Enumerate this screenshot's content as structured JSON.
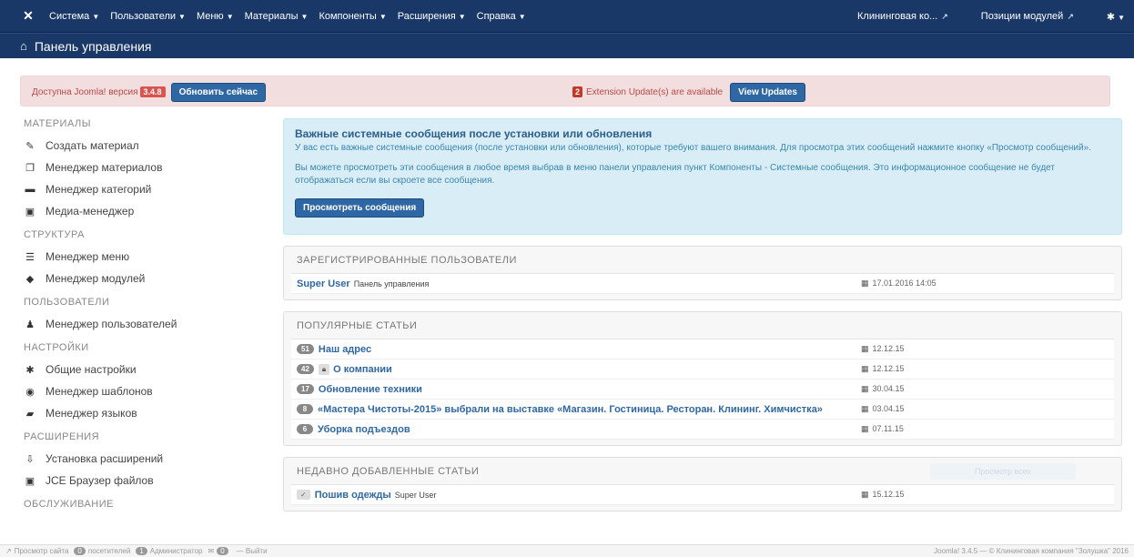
{
  "topbar": {
    "menu": [
      {
        "label": "Система"
      },
      {
        "label": "Пользователи"
      },
      {
        "label": "Меню"
      },
      {
        "label": "Материалы"
      },
      {
        "label": "Компоненты"
      },
      {
        "label": "Расширения"
      },
      {
        "label": "Справка"
      }
    ],
    "site_link": "Клининговая ко...",
    "modules_link": "Позиции модулей"
  },
  "subbar": {
    "title": "Панель управления"
  },
  "alert": {
    "message": "Доступна Joomla! версия",
    "version": "3.4.8",
    "update_button": "Обновить сейчас",
    "ext_count": "2",
    "ext_message": "Extension Update(s) are available",
    "view_updates": "View Updates"
  },
  "sidebar": {
    "sections": [
      {
        "heading": "МАТЕРИАЛЫ",
        "items": [
          {
            "label": "Создать материал",
            "icon": "pencil-icon"
          },
          {
            "label": "Менеджер материалов",
            "icon": "copy-icon"
          },
          {
            "label": "Менеджер категорий",
            "icon": "folder-icon"
          },
          {
            "label": "Медиа-менеджер",
            "icon": "image-icon"
          }
        ]
      },
      {
        "heading": "СТРУКТУРА",
        "items": [
          {
            "label": "Менеджер меню",
            "icon": "list-icon"
          },
          {
            "label": "Менеджер модулей",
            "icon": "cube-icon"
          }
        ]
      },
      {
        "heading": "ПОЛЬЗОВАТЕЛИ",
        "items": [
          {
            "label": "Менеджер пользователей",
            "icon": "users-icon"
          }
        ]
      },
      {
        "heading": "НАСТРОЙКИ",
        "items": [
          {
            "label": "Общие настройки",
            "icon": "gear-icon"
          },
          {
            "label": "Менеджер шаблонов",
            "icon": "eye-icon"
          },
          {
            "label": "Менеджер языков",
            "icon": "comments-icon"
          }
        ]
      },
      {
        "heading": "РАСШИРЕНИЯ",
        "items": [
          {
            "label": "Установка расширений",
            "icon": "upload-icon"
          },
          {
            "label": "JCE Браузер файлов",
            "icon": "image-icon"
          }
        ]
      },
      {
        "heading": "ОБСЛУЖИВАНИЕ",
        "items": []
      }
    ]
  },
  "info": {
    "heading": "Важные системные сообщения после установки или обновления",
    "body1": "У вас есть важные системные сообщения (после установки или обновления), которые требуют вашего внимания. Для просмотра этих сообщений нажмите кнопку «Просмотр сообщений».",
    "body2": "Вы можете просмотреть эти сообщения в любое время выбрав в меню панели управления пункт Компоненты - Системные сообщения. Это информационное сообщение не будет отображаться если вы скроете все сообщения.",
    "button": "Просмотреть сообщения"
  },
  "registered": {
    "title": "ЗАРЕГИСТРИРОВАННЫЕ ПОЛЬЗОВАТЕЛИ",
    "rows": [
      {
        "name": "Super User",
        "location": "Панель управления",
        "date": "17.01.2016 14:05"
      }
    ]
  },
  "popular": {
    "title": "ПОПУЛЯРНЫЕ СТАТЬИ",
    "rows": [
      {
        "hits": "51",
        "title": "Наш адрес",
        "date": "12.12.15",
        "locked": false
      },
      {
        "hits": "42",
        "title": "О компании",
        "date": "12.12.15",
        "locked": true
      },
      {
        "hits": "17",
        "title": "Обновление техники",
        "date": "30.04.15",
        "locked": false
      },
      {
        "hits": "8",
        "title": "«Мастера Чистоты-2015» выбрали на выставке «Магазин. Гостиница. Ресторан. Клининг. Химчистка»",
        "date": "03.04.15",
        "locked": false
      },
      {
        "hits": "6",
        "title": "Уборка подъездов",
        "date": "07.11.15",
        "locked": false
      }
    ]
  },
  "recent": {
    "title": "НЕДАВНО ДОБАВЛЕННЫЕ СТАТЬИ",
    "ghost_button": "Просмотр всех",
    "rows": [
      {
        "title": "Пошив одежды",
        "author": "Super User",
        "date": "15.12.15"
      }
    ]
  },
  "statusbar": {
    "view_site": "Просмотр сайта",
    "visitors_count": "0",
    "visitors_label": "посетителей",
    "admins_count": "1",
    "admins_label": "Администратор",
    "messages_count": "0",
    "logout": "— Выйти",
    "footer": "Joomla! 3.4.5 — © Клининговая компания \"Золушка\" 2016"
  }
}
